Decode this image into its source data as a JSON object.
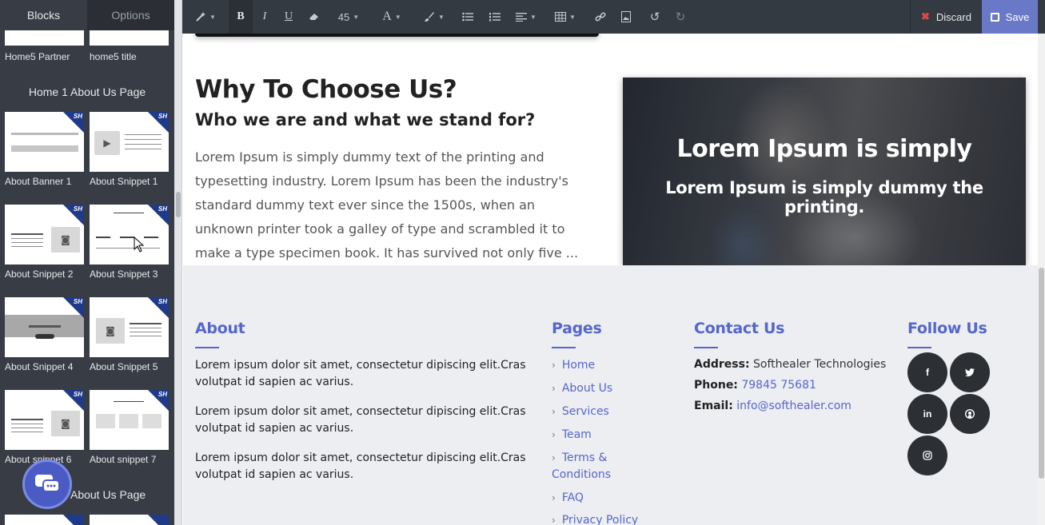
{
  "sidebar": {
    "tabs": [
      {
        "label": "Blocks",
        "active": true
      },
      {
        "label": "Options",
        "active": false
      }
    ],
    "top_labels": [
      "Home5 Partner",
      "home5 title"
    ],
    "group_title": "Home 1 About Us Page",
    "snippets": [
      "About Banner 1",
      "About Snippet 1",
      "About Snippet 2",
      "About Snippet 3",
      "About Snippet 4",
      "About Snippet 5",
      "About snippet 6",
      "About snippet 7"
    ],
    "next_group_title": "Home 2 About Us Page",
    "badge_text": "SH"
  },
  "toolbar": {
    "font_size": "45",
    "discard_label": "Discard",
    "save_label": "Save"
  },
  "section": {
    "title": "Why To Choose Us?",
    "subtitle": "Who we are and what we stand for?",
    "paragraph": "Lorem Ipsum is simply dummy text of the printing and typesetting industry. Lorem Ipsum has been the industry's standard dummy text ever since the 1500s, when an unknown printer took a galley of type and scrambled it to make a type specimen book. It has survived not only five ..."
  },
  "hero": {
    "title": "Lorem Ipsum is simply",
    "subtitle": "Lorem Ipsum is simply dummy the printing."
  },
  "footer": {
    "about": {
      "heading": "About",
      "paragraphs": [
        "Lorem ipsum dolor sit amet, consectetur dipiscing elit.Cras volutpat id sapien ac varius.",
        "Lorem ipsum dolor sit amet, consectetur dipiscing elit.Cras volutpat id sapien ac varius.",
        "Lorem ipsum dolor sit amet, consectetur dipiscing elit.Cras volutpat id sapien ac varius."
      ]
    },
    "pages": {
      "heading": "Pages",
      "links": [
        "Home",
        "About Us",
        "Services",
        "Team",
        "Terms & Conditions",
        "FAQ",
        "Privacy Policy"
      ]
    },
    "contact": {
      "heading": "Contact Us",
      "address_label": "Address:",
      "address": "Softhealer Technologies",
      "phone_label": "Phone:",
      "phone": "79845 75681",
      "email_label": "Email:",
      "email": "info@softhealer.com"
    },
    "follow": {
      "heading": "Follow Us",
      "icons": [
        "facebook-icon",
        "twitter-icon",
        "linkedin-icon",
        "github-icon",
        "instagram-icon"
      ]
    }
  },
  "colors": {
    "accent": "#5566cc",
    "toolbar_bg": "#343a41",
    "sidebar_bg": "#383d45",
    "save_bg": "#6a78c8",
    "discard_x": "#e04848"
  }
}
